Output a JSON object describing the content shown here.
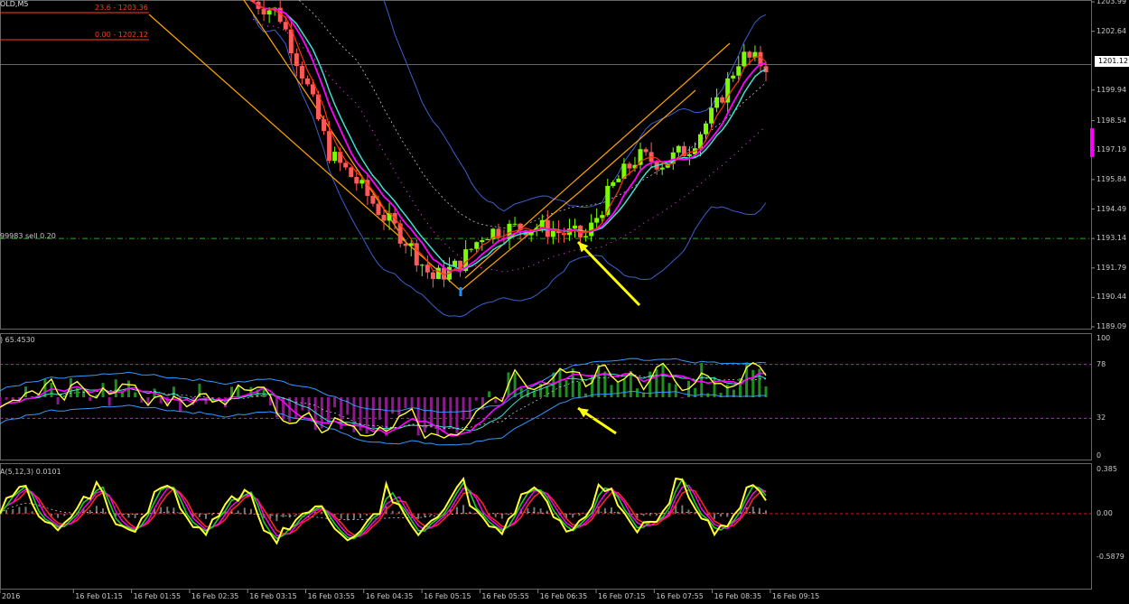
{
  "symbol": "OLD,M5",
  "fib_levels": [
    {
      "label": "23.6 - 1203.36",
      "price": 1203.36
    },
    {
      "label": "0.00 - 1202.12",
      "price": 1202.12
    }
  ],
  "current_price": "1201.12",
  "trade_label": "99983 sell 0.20",
  "price_axis": [
    "1203.99",
    "1202.64",
    "1201.12",
    "1199.94",
    "1198.54",
    "1197.19",
    "1195.84",
    "1194.49",
    "1193.14",
    "1191.79",
    "1190.44",
    "1189.09"
  ],
  "rsi_panel": {
    "title": ") 65.4530",
    "axis": [
      "100",
      "78",
      "32",
      "0"
    ],
    "levels": [
      78,
      32
    ]
  },
  "macd_panel": {
    "title": "A(5,12,3) 0.0101",
    "axis": [
      "0.385",
      "0.00",
      "-0.5879"
    ]
  },
  "time_axis": [
    "2016",
    "16 Feb 01:15",
    "16 Feb 01:55",
    "16 Feb 02:35",
    "16 Feb 03:15",
    "16 Feb 03:55",
    "16 Feb 04:35",
    "16 Feb 05:15",
    "16 Feb 05:55",
    "16 Feb 06:35",
    "16 Feb 07:15",
    "16 Feb 07:55",
    "16 Feb 08:35",
    "16 Feb 09:15"
  ],
  "chart_data": {
    "type": "line",
    "colors": {
      "bull": "#7cfc00",
      "bear": "#ff5a5a",
      "ma_fast": "#ff3300",
      "ma_mid": "#ff00ff",
      "ma_slow": "#40e0d0",
      "bands": "#3a5fcd",
      "channel": "#ffa500",
      "arrow": "#ffff00",
      "hist_up": "#1e8f1e",
      "hist_down": "#8b1a8b"
    },
    "series": [
      {
        "x": [
          0,
          5,
          10,
          15,
          20,
          25,
          30,
          35,
          40,
          45,
          50,
          55,
          60,
          65,
          70,
          75,
          80,
          85,
          90,
          95,
          100
        ],
        "values": [
          1204.0,
          1203.5,
          1200.5,
          1197.0,
          1195.8,
          1194.3,
          1193.0,
          1191.3,
          1191.9,
          1193.4,
          1193.6,
          1193.7,
          1193.4,
          1193.2,
          1195.5,
          1196.9,
          1196.6,
          1197.3,
          1199.0,
          1201.5,
          1201.1
        ]
      }
    ]
  }
}
